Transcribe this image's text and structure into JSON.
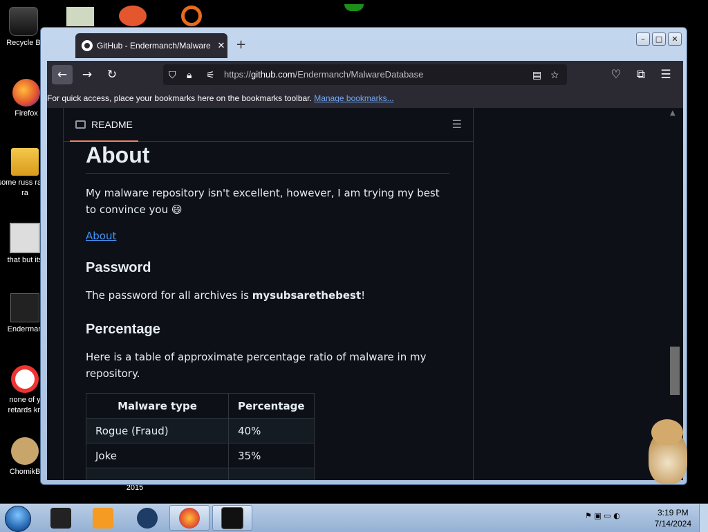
{
  "desktop": {
    "icons": [
      {
        "label": "Recycle B",
        "icon": "recycle-bin-icon"
      },
      {
        "label": "Firefox",
        "icon": "firefox-icon"
      },
      {
        "label": "some russ ran a ra",
        "icon": "exe-icon"
      },
      {
        "label": "that but its",
        "icon": "folder-icon"
      },
      {
        "label": "Enderman",
        "icon": "enderman-icon"
      },
      {
        "label": "none of y retards kn",
        "icon": "opera-icon"
      },
      {
        "label": "ChomikB",
        "icon": "hamster-icon"
      },
      {
        "label": "2015",
        "icon": "folder-icon"
      }
    ]
  },
  "window": {
    "tab_title": "GitHub - Endermanch/Malware",
    "new_tab": "+",
    "controls": {
      "minimize": "–",
      "maximize": "□",
      "close": "✕"
    }
  },
  "navbar": {
    "back": "←",
    "forward": "→",
    "reload": "↻",
    "url_prefix": "https://",
    "url_domain": "github.com",
    "url_path": "/Endermanch/MalwareDatabase"
  },
  "bookmarks_bar": {
    "text": "For quick access, place your bookmarks here on the bookmarks toolbar.",
    "link": "Manage bookmarks..."
  },
  "readme": {
    "tab_label": "README",
    "heading": "About",
    "intro": "My malware repository isn't excellent, however, I am trying my best to convince you 😄",
    "about_link": "About",
    "password_heading": "Password",
    "password_text": "The password for all archives is ",
    "password_value": "mysubsarethebest",
    "password_suffix": "!",
    "percentage_heading": "Percentage",
    "percentage_text": "Here is a table of approximate percentage ratio of malware in my repository.",
    "table": {
      "headers": [
        "Malware type",
        "Percentage"
      ],
      "rows": [
        {
          "type": "Rogue (Fraud)",
          "pct": "40%"
        },
        {
          "type": "Joke",
          "pct": "35%"
        }
      ]
    }
  },
  "taskbar": {
    "clock_time": "3:19 PM",
    "clock_date": "7/14/2024"
  }
}
